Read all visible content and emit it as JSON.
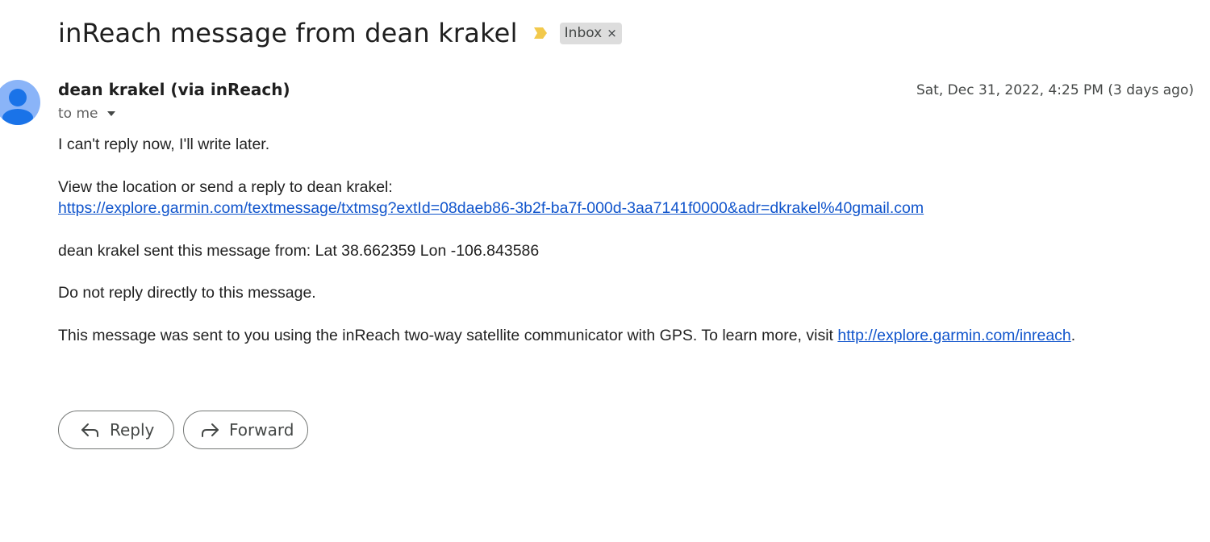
{
  "email": {
    "subject": "inReach message from dean krakel",
    "importance_marker": {
      "icon": "importance-marker-icon",
      "color": "#f2c94c"
    },
    "label_chip": {
      "label": "Inbox",
      "remove_icon": "×"
    },
    "sender": {
      "name": "dean krakel (via inReach)",
      "avatar_color": "#8ab4f8"
    },
    "recipient": "to me",
    "date": "Sat, Dec 31, 2022, 4:25 PM (3 days ago)",
    "body": {
      "line1": "I can't reply now, I'll write later.",
      "line2": "View the location or send a reply to dean krakel:",
      "link1": "https://explore.garmin.com/textmessage/txtmsg?extId=08daeb86-3b2f-ba7f-000d-3aa7141f0000&adr=dkrakel%40gmail.com",
      "line3": "dean krakel sent this message from: Lat 38.662359 Lon -106.843586",
      "line4": "Do not reply directly to this message.",
      "line5_prefix": "This message was sent to you using the inReach two-way satellite communicator with GPS. To learn more, visit ",
      "line5_link": "http://explore.garmin.com/inreach",
      "line5_suffix": "."
    },
    "actions": {
      "reply_label": "Reply",
      "forward_label": "Forward"
    },
    "colors": {
      "link": "#1155cc",
      "text": "#222222",
      "chip_bg": "#dddddd"
    }
  }
}
